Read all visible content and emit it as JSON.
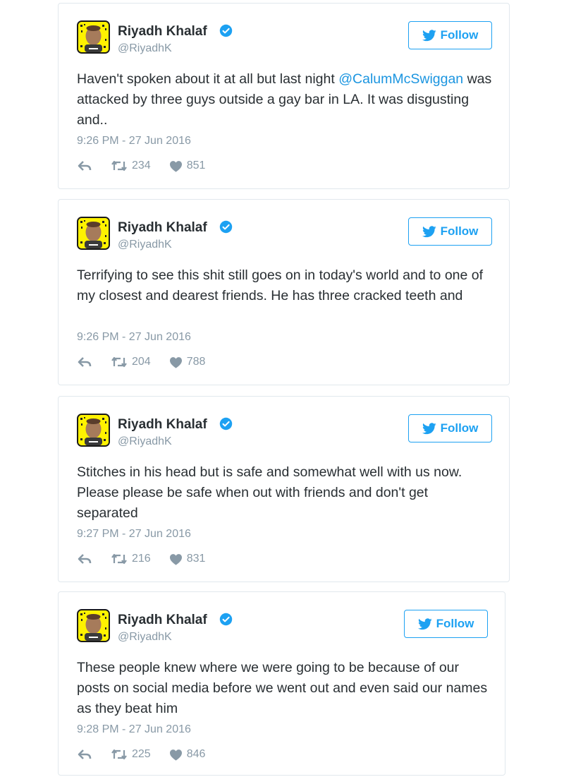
{
  "follow_label": "Follow",
  "colors": {
    "link": "#1b95e0",
    "twitter_blue": "#1da1f2",
    "meta": "#8899a6",
    "text": "#292f33"
  },
  "icons": [
    "avatar-snapcode",
    "verified-badge-icon",
    "twitter-bird-icon",
    "reply-icon",
    "retweet-icon",
    "heart-icon"
  ],
  "tweets": [
    {
      "name": "Riyadh Khalaf",
      "handle": "@RiyadhK",
      "text_before": "Haven't spoken about it at all but last night ",
      "mention": "@CalumMcSwiggan",
      "text_after": " was attacked by three guys outside a gay bar in LA. It was disgusting and..",
      "time": "9:26 PM - 27 Jun 2016",
      "retweets": "234",
      "likes": "851"
    },
    {
      "name": "Riyadh Khalaf",
      "handle": "@RiyadhK",
      "text_before": "Terrifying to see this shit still goes on in today's world and to one of my closest and dearest friends. He has three cracked teeth and",
      "mention": "",
      "text_after": "",
      "time": "9:26 PM - 27 Jun 2016",
      "retweets": "204",
      "likes": "788"
    },
    {
      "name": "Riyadh Khalaf",
      "handle": "@RiyadhK",
      "text_before": "Stitches in his head but is safe and somewhat well with us now. Please please be safe when out with friends and don't get separated",
      "mention": "",
      "text_after": "",
      "time": "9:27 PM - 27 Jun 2016",
      "retweets": "216",
      "likes": "831"
    },
    {
      "name": "Riyadh Khalaf",
      "handle": "@RiyadhK",
      "text_before": "These people knew where we were going to be because of our posts on social media before we went out and even said our names as they beat him",
      "mention": "",
      "text_after": "",
      "time": "9:28 PM - 27 Jun 2016",
      "retweets": "225",
      "likes": "846"
    }
  ]
}
